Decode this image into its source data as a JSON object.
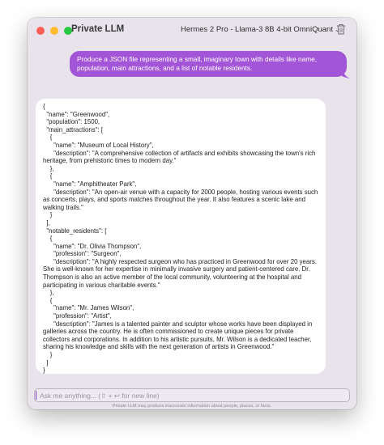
{
  "window": {
    "title": "Private LLM",
    "model_label": "Hermes 2 Pro - Llama-3 8B 4-bit OmniQuant",
    "model_chevron_icon": "chevron-down-icon",
    "trash_icon": "trash-icon"
  },
  "colors": {
    "user_bubble": "#a355d8",
    "window_bg": "#e9e4ec",
    "traffic_red": "#fe5f57",
    "traffic_yellow": "#febc2e",
    "traffic_green": "#28c840"
  },
  "messages": [
    {
      "role": "user",
      "text": "Produce a JSON file representing a small, imaginary town with details like name, population, main attractions, and a list of notable residents."
    },
    {
      "role": "assistant",
      "text": "{\n  \"name\": \"Greenwood\",\n  \"population\": 1500,\n  \"main_attractions\": [\n    {\n      \"name\": \"Museum of Local History\",\n      \"description\": \"A comprehensive collection of artifacts and exhibits showcasing the town's rich heritage, from prehistoric times to modern day.\"\n    },\n    {\n      \"name\": \"Amphitheater Park\",\n      \"description\": \"An open-air venue with a capacity for 2000 people, hosting various events such as concerts, plays, and sports matches throughout the year. It also features a scenic lake and walking trails.\"\n    }\n  ],\n  \"notable_residents\": [\n    {\n      \"name\": \"Dr. Olivia Thompson\",\n      \"profession\": \"Surgeon\",\n      \"description\": \"A highly respected surgeon who has practiced in Greenwood for over 20 years. She is well-known for her expertise in minimally invasive surgery and patient-centered care. Dr. Thompson is also an active member of the local community, volunteering at the hospital and participating in various charitable events.\"\n    },\n    {\n      \"name\": \"Mr. James Wilson\",\n      \"profession\": \"Artist\",\n      \"description\": \"James is a talented painter and sculptor whose works have been displayed in galleries across the country. He is often commissioned to create unique pieces for private collectors and corporations. In addition to his artistic pursuits, Mr. Wilson is a dedicated teacher, sharing his knowledge and skills with the next generation of artists in Greenwood.\"\n    }\n  ]\n}"
    }
  ],
  "input": {
    "placeholder": "Ask me anything... (⇧ + ↩ for new line)",
    "value": ""
  },
  "disclaimer": "Private LLM may produce inaccurate information about people, places, or facts."
}
